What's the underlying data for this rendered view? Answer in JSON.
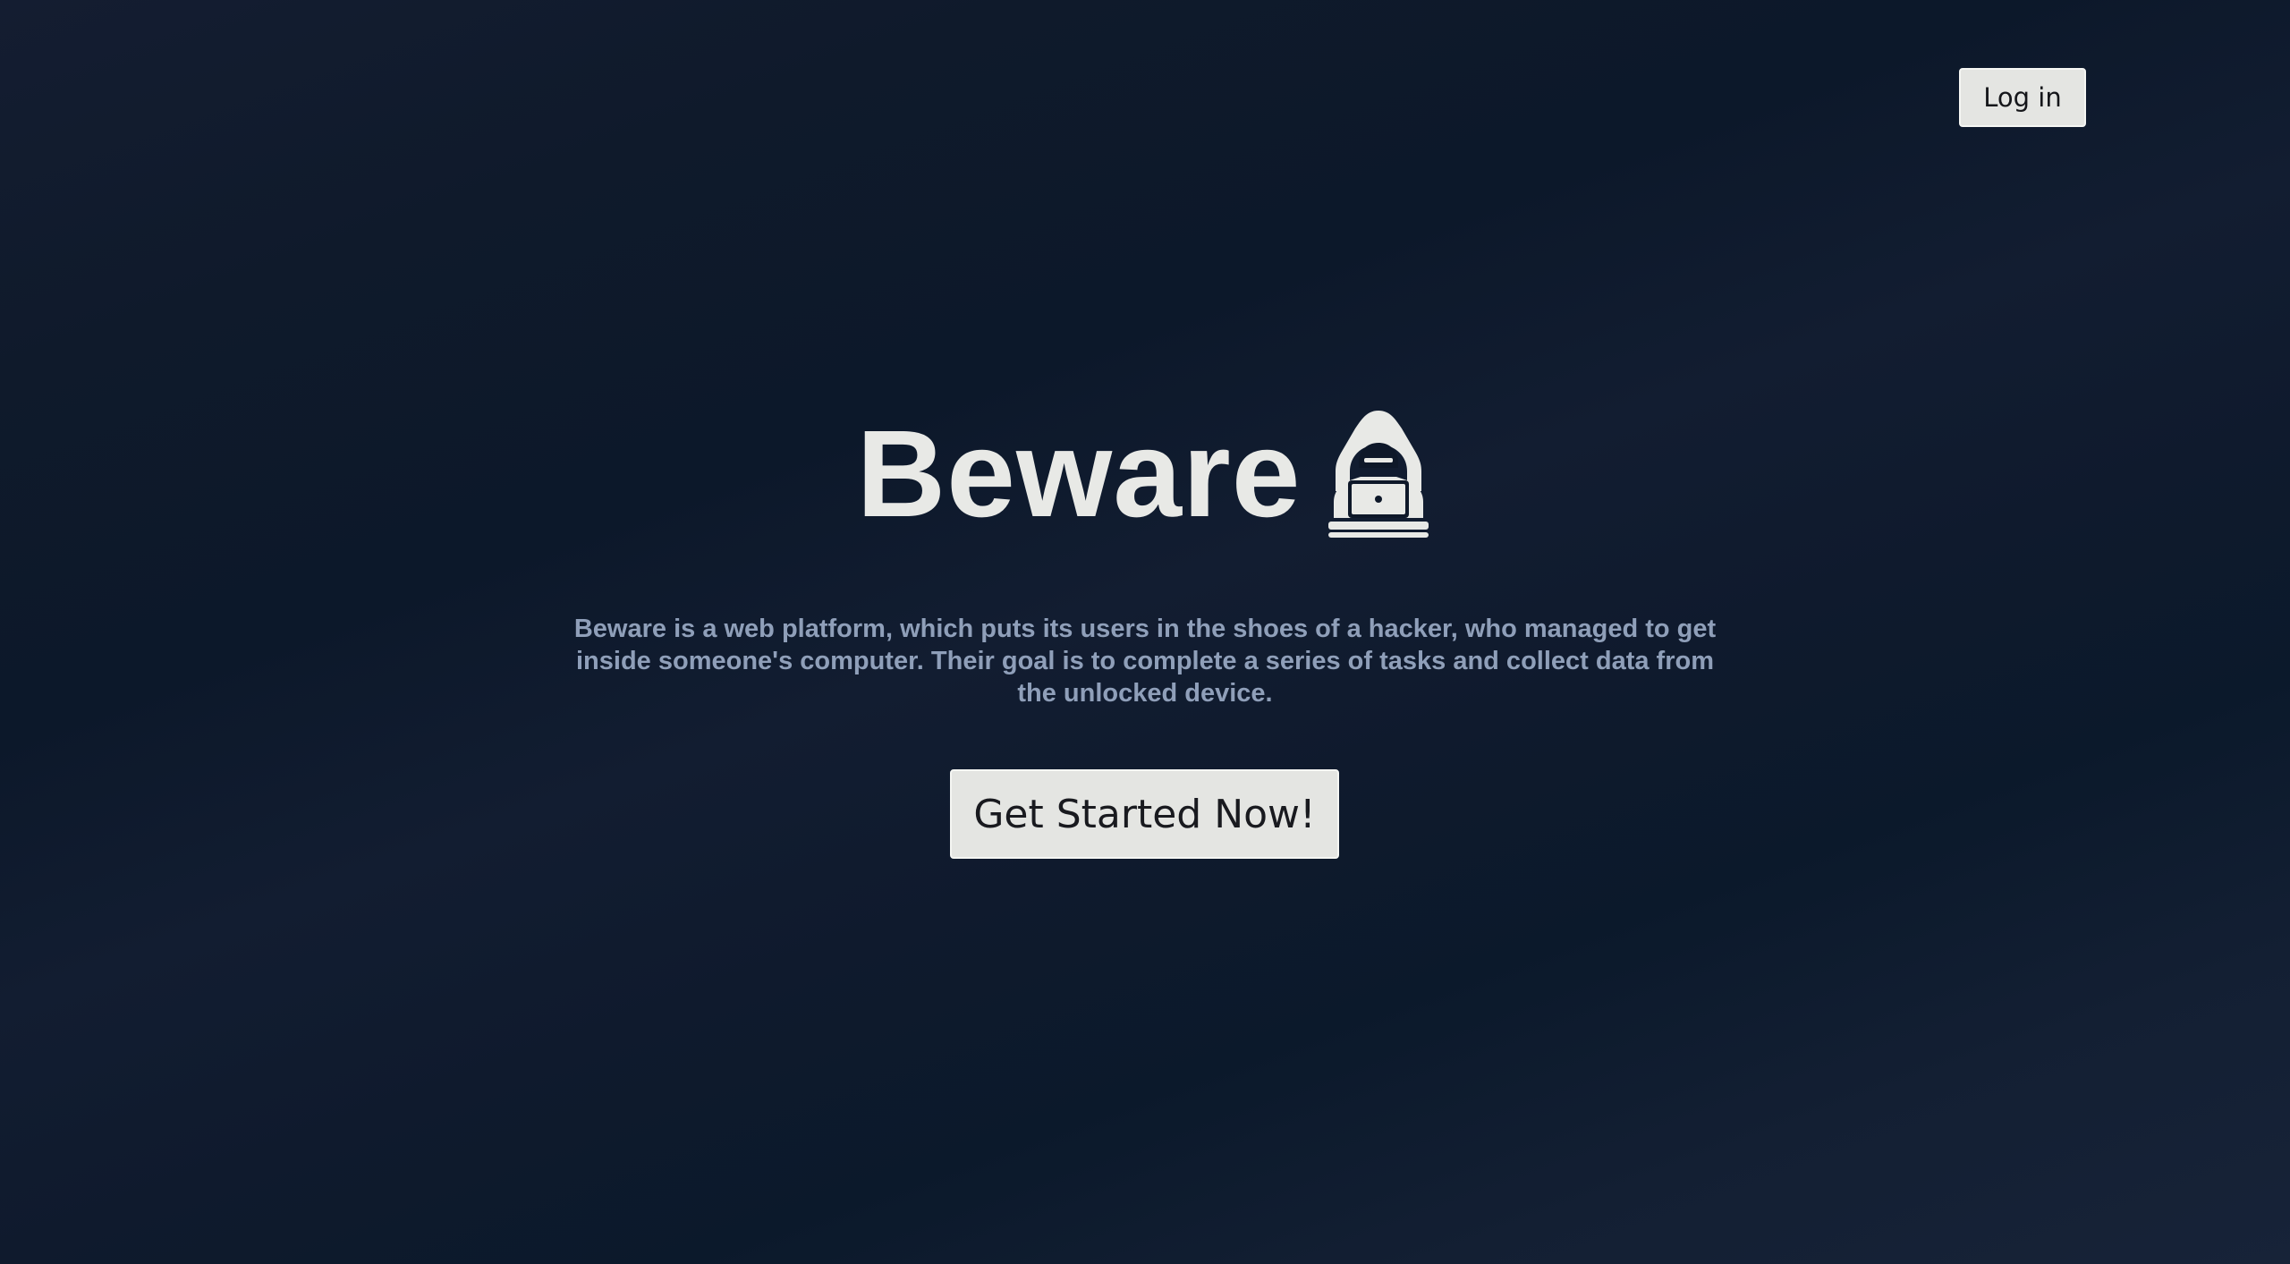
{
  "header": {
    "login_label": "Log in"
  },
  "hero": {
    "title": "Beware",
    "icon": "hacker-icon",
    "description": "Beware is a web platform, which puts its users in the shoes of a hacker, who managed to get inside someone's computer. Their goal is to complete a series of tasks and collect data from the unlocked device.",
    "cta_label": "Get Started Now!"
  },
  "colors": {
    "background": "#0f1a2b",
    "title": "#e8e9e6",
    "description": "#8f9fb9",
    "button_bg": "#e4e5e2",
    "button_text": "#15161a"
  }
}
